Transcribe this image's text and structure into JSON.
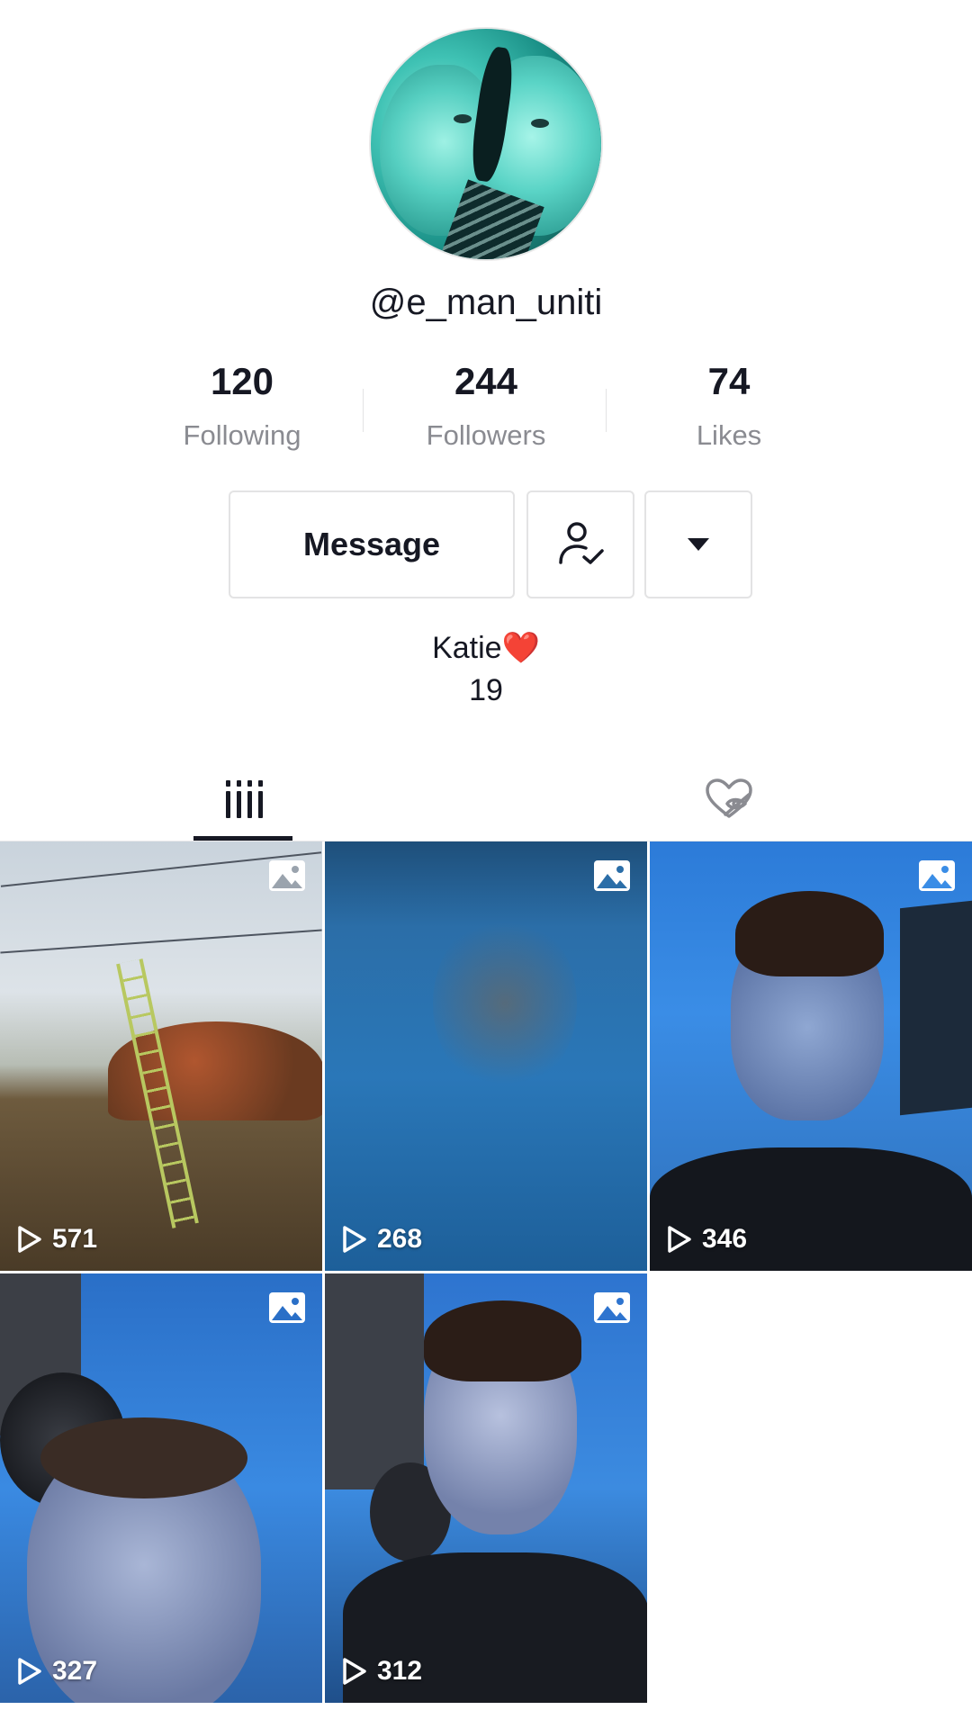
{
  "profile": {
    "username": "@e_man_uniti",
    "avatar_icon": "profile-avatar"
  },
  "stats": {
    "following": {
      "value": "120",
      "label": "Following"
    },
    "followers": {
      "value": "244",
      "label": "Followers"
    },
    "likes": {
      "value": "74",
      "label": "Likes"
    }
  },
  "actions": {
    "message_label": "Message",
    "follow_icon": "user-check-icon",
    "more_icon": "caret-down-icon"
  },
  "bio": {
    "name": "Katie❤️",
    "age": "19"
  },
  "tabs": [
    {
      "name": "videos",
      "icon": "grid-bars-icon",
      "active": true
    },
    {
      "name": "liked",
      "icon": "heart-hidden-icon",
      "active": false
    }
  ],
  "videos": [
    {
      "views": "571",
      "type_icon": "photo-icon"
    },
    {
      "views": "268",
      "type_icon": "photo-icon"
    },
    {
      "views": "346",
      "type_icon": "photo-icon"
    },
    {
      "views": "327",
      "type_icon": "photo-icon"
    },
    {
      "views": "312",
      "type_icon": "photo-icon"
    }
  ],
  "colors": {
    "text_primary": "#161823",
    "text_secondary": "#8a8b91",
    "border": "#e3e3e4"
  }
}
